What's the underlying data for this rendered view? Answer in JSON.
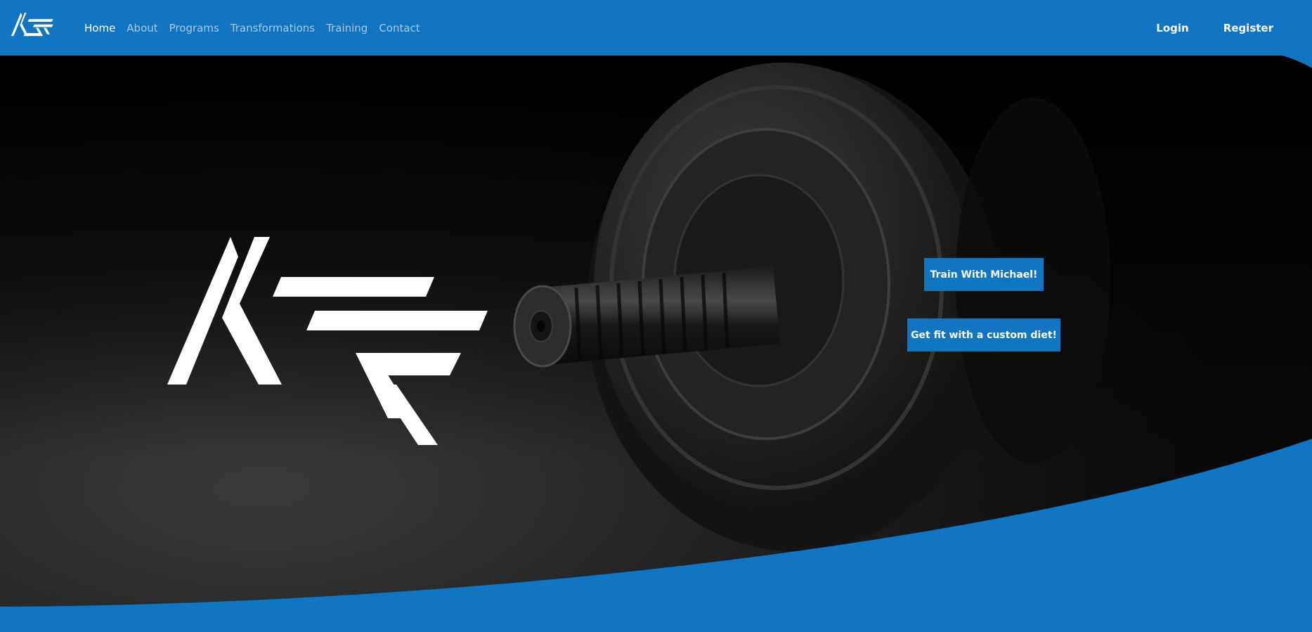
{
  "brand": {
    "logo_text": "MSF",
    "primary_color": "#1175c1",
    "logo_color": "#ffffff"
  },
  "nav": {
    "items": [
      {
        "label": "Home",
        "active": true
      },
      {
        "label": "About",
        "active": false
      },
      {
        "label": "Programs",
        "active": false
      },
      {
        "label": "Transformations",
        "active": false
      },
      {
        "label": "Training",
        "active": false
      },
      {
        "label": "Contact",
        "active": false
      }
    ],
    "login_label": "Login",
    "register_label": "Register"
  },
  "hero": {
    "background": "dark photo of a dumbbell weight plate",
    "cta_train_label": "Train With Michael!",
    "cta_diet_label": "Get fit with a custom diet!"
  }
}
